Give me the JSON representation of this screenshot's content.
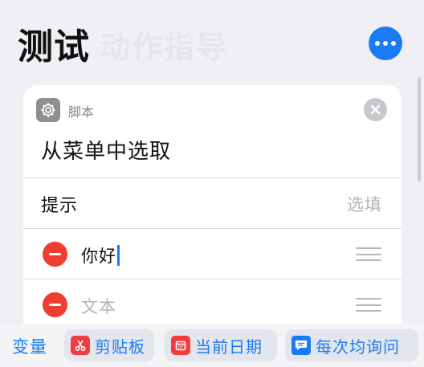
{
  "header": {
    "title": "测试",
    "background_title": "动作指导",
    "more_icon": "ellipsis-icon"
  },
  "action_card": {
    "category": "脚本",
    "category_icon": "gear-icon",
    "title": "从菜单中选取",
    "prompt": {
      "label": "提示",
      "placeholder": "选填"
    },
    "items": [
      {
        "value": "你好",
        "placeholder": "",
        "focused": true
      },
      {
        "value": "",
        "placeholder": "文本",
        "focused": false
      }
    ]
  },
  "toolbar": {
    "variables_label": "变量",
    "chips": [
      {
        "label": "剪贴板",
        "icon": "scissors-icon"
      },
      {
        "label": "当前日期",
        "icon": "calendar-icon"
      },
      {
        "label": "每次均询问",
        "icon": "speech-bubble-icon"
      }
    ]
  },
  "colors": {
    "accent": "#1a7cf5",
    "delete": "#ef3d32",
    "background": "#efeff4"
  }
}
